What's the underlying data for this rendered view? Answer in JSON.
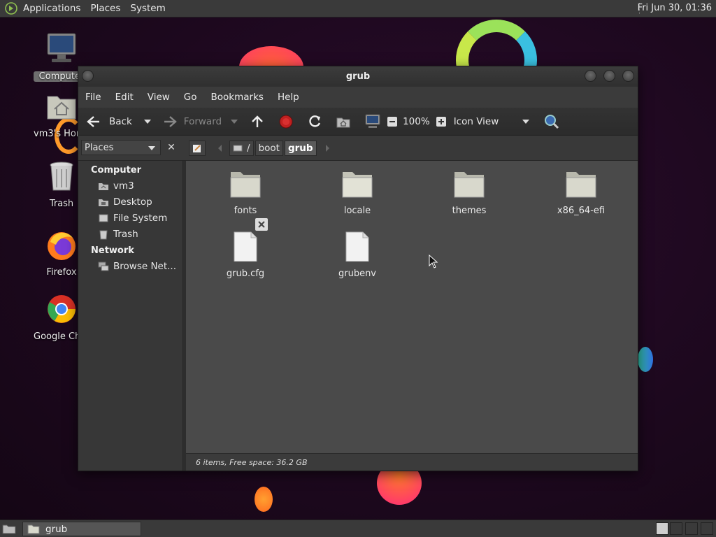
{
  "top_panel": {
    "menus": [
      "Applications",
      "Places",
      "System"
    ],
    "clock": "Fri Jun 30, 01:36"
  },
  "desktop": {
    "icons": [
      {
        "label": "Computer",
        "icon": "computer-icon"
      },
      {
        "label": "vm3's Home",
        "icon": "home-folder-icon"
      },
      {
        "label": "Trash",
        "icon": "trash-icon"
      },
      {
        "label": "Firefox",
        "icon": "firefox-icon"
      },
      {
        "label": "Google Chrome",
        "icon": "chrome-icon"
      }
    ]
  },
  "window": {
    "title": "grub",
    "menubar": [
      "File",
      "Edit",
      "View",
      "Go",
      "Bookmarks",
      "Help"
    ],
    "toolbar": {
      "back": "Back",
      "forward": "Forward",
      "zoom": "100%",
      "view_mode": "Icon View"
    },
    "location": {
      "places_label": "Places",
      "close": "✕",
      "path": [
        "/",
        "boot",
        "grub"
      ]
    },
    "sidebar": {
      "computer_heading": "Computer",
      "computer_items": [
        {
          "label": "vm3",
          "icon": "home-icon"
        },
        {
          "label": "Desktop",
          "icon": "desktop-icon"
        },
        {
          "label": "File System",
          "icon": "drive-icon"
        },
        {
          "label": "Trash",
          "icon": "trash-icon"
        }
      ],
      "network_heading": "Network",
      "network_items": [
        {
          "label": "Browse Net...",
          "icon": "network-icon"
        }
      ]
    },
    "files": [
      {
        "name": "fonts",
        "type": "folder"
      },
      {
        "name": "locale",
        "type": "folder"
      },
      {
        "name": "themes",
        "type": "folder"
      },
      {
        "name": "x86_64-efi",
        "type": "folder"
      },
      {
        "name": "grub.cfg",
        "type": "file"
      },
      {
        "name": "grubenv",
        "type": "file"
      }
    ],
    "status": "6 items, Free space: 36.2 GB"
  },
  "bottom_panel": {
    "task_label": "grub"
  },
  "colors": {
    "panel": "#3a3a3a",
    "window_bg": "#3b3b3b",
    "content_bg": "#4a4a4a",
    "folder": "#d8d8cc",
    "stop": "#c02020"
  }
}
